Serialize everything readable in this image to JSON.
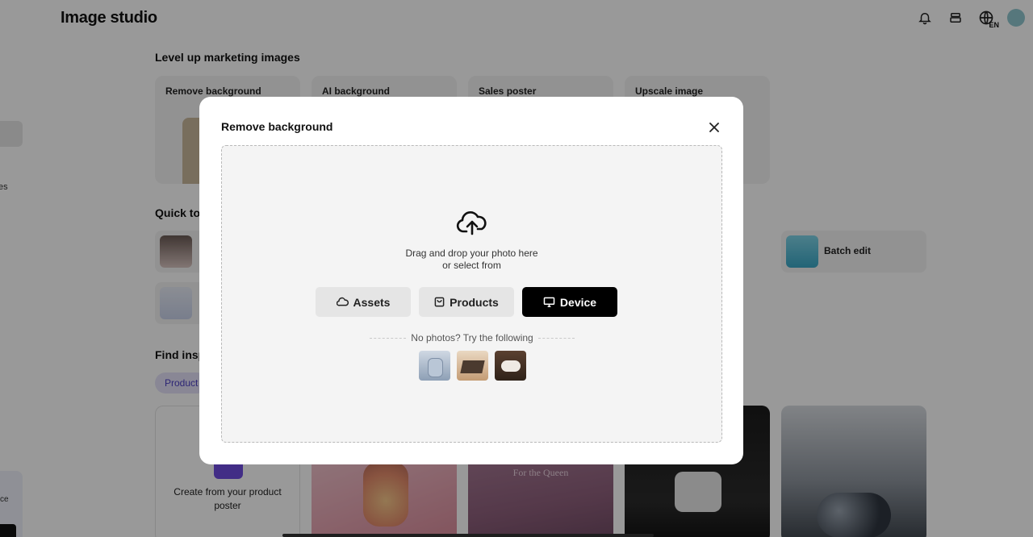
{
  "app": {
    "title": "Image studio",
    "language_code": "EN"
  },
  "header_icons": [
    "bell-icon",
    "stack-icon",
    "globe-icon"
  ],
  "sidebar": {
    "fragment_es": "es",
    "fragment_ce": "ce"
  },
  "sections": {
    "level_up": {
      "heading": "Level up marketing images",
      "cards": [
        "Remove background",
        "AI background",
        "Sales poster",
        "Upscale image"
      ]
    },
    "quick_tools": {
      "heading": "Quick to",
      "items": [
        {
          "label": ""
        },
        {
          "label": ""
        },
        {
          "label": "Batch edit"
        }
      ]
    },
    "find_inspiration": {
      "heading": "Find insp",
      "chip": "Product",
      "create_card": "Create from your product poster",
      "poster_text": "For the Queen"
    }
  },
  "modal": {
    "title": "Remove background",
    "drop_line1": "Drag and drop your photo here",
    "drop_line2": "or select from",
    "buttons": {
      "assets": "Assets",
      "products": "Products",
      "device": "Device"
    },
    "try_text": "No photos? Try the following",
    "samples": [
      "earbuds-sample",
      "jewelry-box-sample",
      "cushion-sample"
    ]
  },
  "colors": {
    "primary_button": "#000000",
    "chip_text": "#4b3fc4",
    "overlay": "rgba(0,0,0,0.40)"
  }
}
